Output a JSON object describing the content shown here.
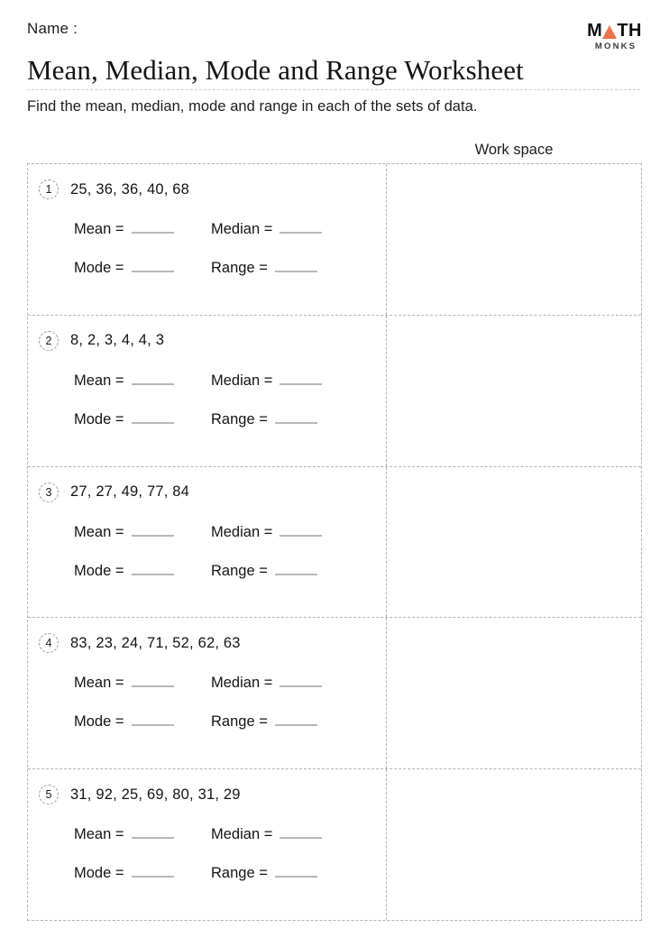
{
  "header": {
    "name_label": "Name :",
    "title": "Mean, Median, Mode and Range Worksheet",
    "subtitle": "Find the mean, median, mode and range in each of the sets of data.",
    "workspace_label": "Work space"
  },
  "logo": {
    "main_before": "M",
    "main_after": "TH",
    "subtext": "MONKS",
    "triangle_color": "#ED7349",
    "icon": "triangle-icon"
  },
  "labels": {
    "mean": "Mean =",
    "median": "Median =",
    "mode": "Mode =",
    "range": "Range ="
  },
  "problems": [
    {
      "number": "1",
      "dataset": "25, 36, 36, 40, 68"
    },
    {
      "number": "2",
      "dataset": "8, 2, 3, 4, 4, 3"
    },
    {
      "number": "3",
      "dataset": "27, 27, 49, 77, 84"
    },
    {
      "number": "4",
      "dataset": "83, 23, 24, 71, 52, 62, 63"
    },
    {
      "number": "5",
      "dataset": "31, 92, 25, 69, 80, 31, 29"
    }
  ],
  "colors": {
    "accent": "#ED7349",
    "border_dashed": "#b4b4b4",
    "blank_line": "#b8b8b8",
    "text": "#141414"
  }
}
